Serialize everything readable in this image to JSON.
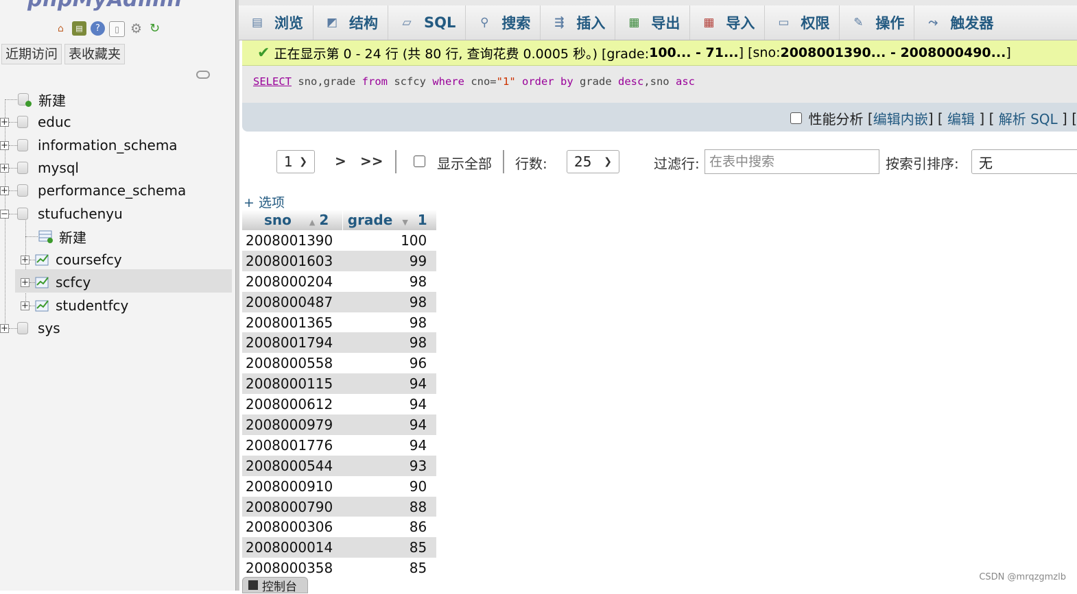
{
  "app": {
    "logo_text": "phpMyAdmin"
  },
  "nav": {
    "icons": [
      "home-icon",
      "logout-icon",
      "help-icon",
      "docs-icon",
      "settings-icon",
      "reload-icon"
    ],
    "tabs": [
      "近期访问",
      "表收藏夹"
    ],
    "tree": {
      "new_label": "新建",
      "databases": [
        "educ",
        "information_schema",
        "mysql",
        "performance_schema",
        "stufuchenyu",
        "sys"
      ],
      "expanded_db_new": "新建",
      "tables": [
        "coursefcy",
        "scfcy",
        "studentfcy"
      ],
      "selected_table": "scfcy"
    }
  },
  "tabs": [
    {
      "label": "浏览",
      "icon": "browse-icon"
    },
    {
      "label": "结构",
      "icon": "structure-icon"
    },
    {
      "label": "SQL",
      "icon": "sql-icon"
    },
    {
      "label": "搜索",
      "icon": "search-icon"
    },
    {
      "label": "插入",
      "icon": "insert-icon"
    },
    {
      "label": "导出",
      "icon": "export-icon"
    },
    {
      "label": "导入",
      "icon": "import-icon"
    },
    {
      "label": "权限",
      "icon": "privileges-icon"
    },
    {
      "label": "操作",
      "icon": "operations-icon"
    },
    {
      "label": "触发器",
      "icon": "triggers-icon"
    }
  ],
  "notice": {
    "prefix": "正在显示第 0 - 24 行 (共 80 行, 查询花费 0.0005 秒。) [grade: ",
    "grade_range": "100... - 71...",
    "mid": "] [sno: ",
    "sno_range": "2008001390... - 2008000490...",
    "suffix": "]"
  },
  "sql": {
    "select": "SELECT",
    "p1": " sno,grade ",
    "from": "from",
    "p2": " scfcy ",
    "where": "where",
    "p3": " cno=",
    "val": "\"1\"",
    "p4": " ",
    "order_by": "order by",
    "p5": " grade ",
    "desc": "desc",
    "p6": ",sno ",
    "asc": "asc"
  },
  "profiling": {
    "label": "性能分析",
    "edit_inline": "编辑内嵌",
    "edit": "编辑",
    "explain": "解析 SQL"
  },
  "pager": {
    "page": "1",
    "next": ">",
    "last": ">>",
    "show_all": "显示全部",
    "rows_label": "行数:",
    "rows_value": "25",
    "filter_label": "过滤行:",
    "filter_placeholder": "在表中搜索",
    "sort_label": "按索引排序:",
    "sort_value": "无"
  },
  "options_label": "+ 选项",
  "table": {
    "columns": [
      {
        "name": "sno",
        "sort_dir": "asc",
        "sort_order": "2"
      },
      {
        "name": "grade",
        "sort_dir": "desc",
        "sort_order": "1"
      }
    ],
    "rows": [
      [
        "2008001390",
        "100"
      ],
      [
        "2008001603",
        "99"
      ],
      [
        "2008000204",
        "98"
      ],
      [
        "2008000487",
        "98"
      ],
      [
        "2008001365",
        "98"
      ],
      [
        "2008001794",
        "98"
      ],
      [
        "2008000558",
        "96"
      ],
      [
        "2008000115",
        "94"
      ],
      [
        "2008000612",
        "94"
      ],
      [
        "2008000979",
        "94"
      ],
      [
        "2008001776",
        "94"
      ],
      [
        "2008000544",
        "93"
      ],
      [
        "2008000910",
        "90"
      ],
      [
        "2008000790",
        "88"
      ],
      [
        "2008000306",
        "86"
      ],
      [
        "2008000014",
        "85"
      ],
      [
        "2008000358",
        "85"
      ]
    ]
  },
  "console_label": "控制台",
  "watermark": "CSDN @mrqzgmzlb",
  "colors": {
    "accent": "#235a81",
    "notice_bg": "#ebf8a4",
    "row_alt": "#dfdfdf"
  }
}
